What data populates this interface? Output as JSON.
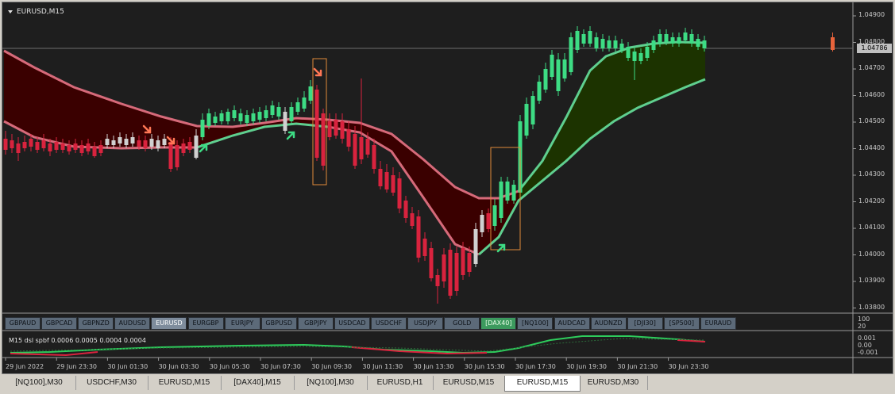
{
  "chart": {
    "title": "EURUSD,M15",
    "current_price": "1.04786",
    "price_ticks": [
      "1.04900",
      "1.04800",
      "1.04700",
      "1.04600",
      "1.04500",
      "1.04400",
      "1.04300",
      "1.04200",
      "1.04100",
      "1.04000",
      "1.03900",
      "1.03800"
    ],
    "time_ticks": [
      "29 Jun 2022",
      "29 Jun 23:30",
      "30 Jun 01:30",
      "30 Jun 03:30",
      "30 Jun 05:30",
      "30 Jun 07:30",
      "30 Jun 09:30",
      "30 Jun 11:30",
      "30 Jun 13:30",
      "30 Jun 15:30",
      "30 Jun 17:30",
      "30 Jun 19:30",
      "30 Jun 21:30",
      "30 Jun 23:30"
    ],
    "colors": {
      "bull": "#3ddc84",
      "bear": "#d9233e",
      "neutral": "#d0d0d0",
      "cloud_bear": "#3a0000",
      "cloud_bull": "#1c3300",
      "band_bear": "#d66a7a",
      "band_bull": "#5fcf8f",
      "box": "#e08a3a"
    }
  },
  "symbols": [
    {
      "label": "GBPAUD",
      "state": "normal"
    },
    {
      "label": "GBPCAD",
      "state": "normal"
    },
    {
      "label": "GBPNZD",
      "state": "normal"
    },
    {
      "label": "AUDUSD",
      "state": "normal"
    },
    {
      "label": "EURUSD",
      "state": "active"
    },
    {
      "label": "EURGBP",
      "state": "normal"
    },
    {
      "label": "EURJPY",
      "state": "normal"
    },
    {
      "label": "GBPUSD",
      "state": "normal"
    },
    {
      "label": "GBPJPY",
      "state": "normal"
    },
    {
      "label": "USDCAD",
      "state": "normal"
    },
    {
      "label": "USDCHF",
      "state": "normal"
    },
    {
      "label": "USDJPY",
      "state": "normal"
    },
    {
      "label": "GOLD",
      "state": "normal"
    },
    {
      "label": "[DAX40]",
      "state": "green"
    },
    {
      "label": "[NQ100]",
      "state": "normal"
    },
    {
      "label": "AUDCAD",
      "state": "normal"
    },
    {
      "label": "AUDNZD",
      "state": "normal"
    },
    {
      "label": "[DJI30]",
      "state": "normal"
    },
    {
      "label": "[SP500]",
      "state": "normal"
    },
    {
      "label": "EURAUD",
      "state": "normal"
    }
  ],
  "symbol_panel_scale": [
    "100",
    "20"
  ],
  "indicator": {
    "label": "M15 dsl spbf 0.0006 0.0005 0.0004 0.0004",
    "ticks": [
      "0.001",
      "0.00",
      "-0.001"
    ]
  },
  "tabs": [
    {
      "label": "[NQ100],M30",
      "active": false
    },
    {
      "label": "USDCHF,M30",
      "active": false
    },
    {
      "label": "EURUSD,M15",
      "active": false
    },
    {
      "label": "[DAX40],M15",
      "active": false
    },
    {
      "label": "[NQ100],M30",
      "active": false
    },
    {
      "label": "EURUSD,H1",
      "active": false
    },
    {
      "label": "EURUSD,M15",
      "active": false
    },
    {
      "label": "EURUSD,M15",
      "active": true
    },
    {
      "label": "EURUSD,M30",
      "active": false
    }
  ]
}
